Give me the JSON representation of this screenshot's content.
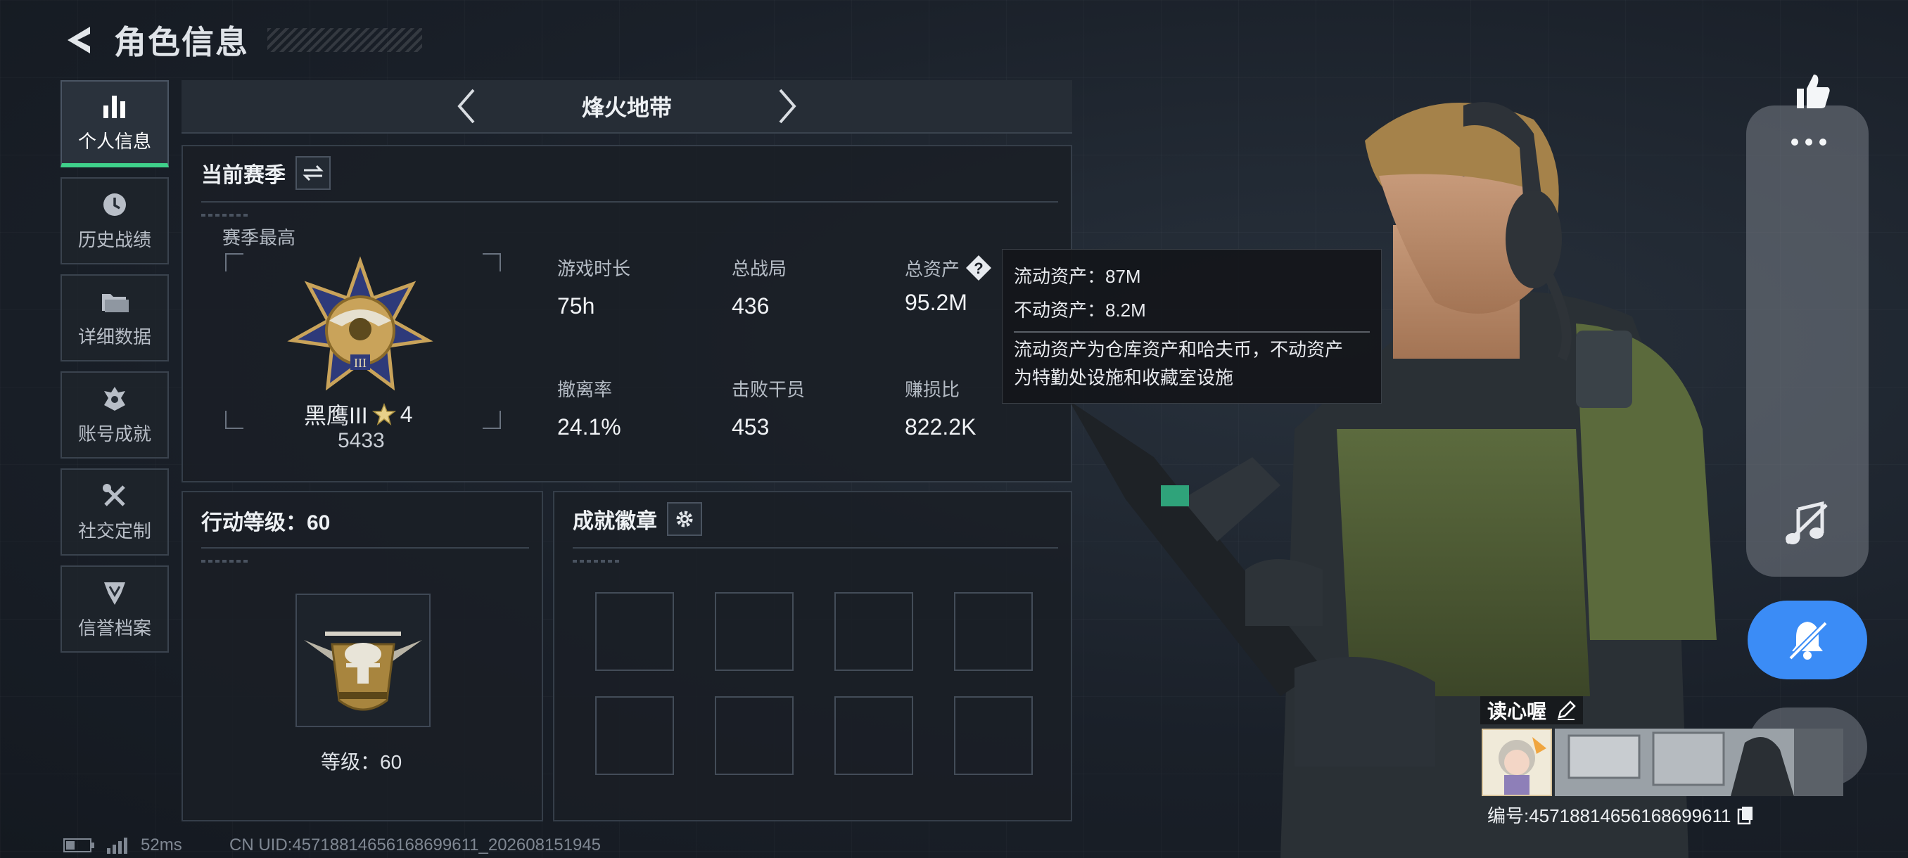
{
  "header": {
    "title": "角色信息"
  },
  "nav": {
    "items": [
      {
        "label": "个人信息",
        "active": true
      },
      {
        "label": "历史战绩"
      },
      {
        "label": "详细数据"
      },
      {
        "label": "账号成就"
      },
      {
        "label": "社交定制"
      },
      {
        "label": "信誉档案"
      }
    ]
  },
  "mode": {
    "title": "烽火地带"
  },
  "season": {
    "header": "当前赛季",
    "best_label": "赛季最高",
    "rank_name": "黑鹰III",
    "rank_stars": "4",
    "rank_score": "5433",
    "stats": [
      {
        "label": "游戏时长",
        "value": "75h"
      },
      {
        "label": "总战局",
        "value": "436"
      },
      {
        "label": "总资产",
        "value": "95.2M"
      },
      {
        "label": "撤离率",
        "value": "24.1%"
      },
      {
        "label": "击败干员",
        "value": "453"
      },
      {
        "label": "赚损比",
        "value": "822.2K"
      }
    ]
  },
  "tooltip": {
    "liquid": "流动资产：87M",
    "fixed": "不动资产：8.2M",
    "desc_line1": "流动资产为仓库资产和哈夫币，不动资产",
    "desc_line2": "为特勤处设施和收藏室设施"
  },
  "level": {
    "header": "行动等级：60",
    "label": "等级：60"
  },
  "achievements": {
    "header": "成就徽章"
  },
  "player": {
    "name": "读心喔",
    "id": "编号:457188146561686996​11"
  },
  "status": {
    "ping": "52ms",
    "uid": "CN UID:457188146561686996​11_202608151945"
  },
  "colors": {
    "accent_green": "#3fd18b",
    "mute_blue": "#3b8cf6"
  }
}
